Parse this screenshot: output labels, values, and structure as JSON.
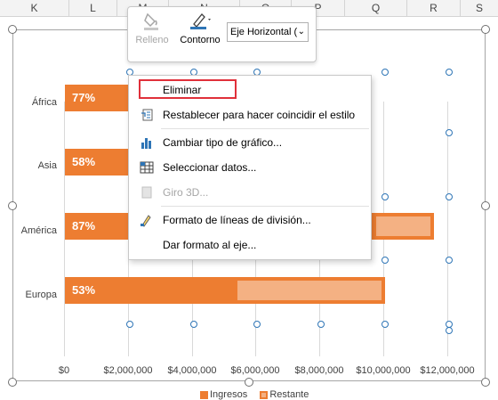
{
  "columns": [
    "K",
    "L",
    "M",
    "N",
    "O",
    "P",
    "Q",
    "R",
    "S"
  ],
  "chart_data": {
    "type": "bar",
    "orientation": "horizontal",
    "stacked": true,
    "categories": [
      "África",
      "Asia",
      "América",
      "Europa"
    ],
    "series": [
      {
        "name": "Ingresos",
        "values": [
          null,
          null,
          null,
          5300000
        ],
        "color": "#ed7d31"
      },
      {
        "name": "Restante",
        "values": [
          null,
          null,
          null,
          4700000
        ],
        "color": "#f4b183"
      }
    ],
    "data_labels": [
      "77%",
      "58%",
      "87%",
      "53%"
    ],
    "xticks": [
      "$0",
      "$2,000,000",
      "$4,000,000",
      "$6,000,000",
      "$8,000,000",
      "$10,000,000",
      "$12,000,000"
    ],
    "xlim": [
      0,
      12000000
    ],
    "grid": true,
    "legend": "bottom"
  },
  "toolbar": {
    "fill_label": "Relleno",
    "outline_label": "Contorno",
    "element_select": "Eje Horizontal (",
    "colors": {
      "outline_accent": "#2e75b6",
      "fill_icon": "#a6a6a6"
    }
  },
  "context_menu": {
    "items": [
      {
        "label": "Eliminar",
        "icon": "",
        "disabled": false
      },
      {
        "label": "Restablecer para hacer coincidir el estilo",
        "icon": "reset-style-icon",
        "disabled": false
      },
      {
        "label": "Cambiar tipo de gráfico...",
        "icon": "chart-type-icon",
        "disabled": false
      },
      {
        "label": "Seleccionar datos...",
        "icon": "select-data-icon",
        "disabled": false
      },
      {
        "label": "Giro 3D...",
        "icon": "rotate-3d-icon",
        "disabled": true
      },
      {
        "label": "Formato de líneas de división...",
        "icon": "gridline-format-icon",
        "disabled": false
      },
      {
        "label": "Dar formato al eje...",
        "icon": "",
        "disabled": false
      }
    ],
    "highlight_color": "#e0303a"
  }
}
